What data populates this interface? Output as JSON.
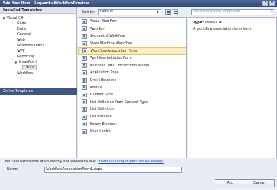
{
  "window": {
    "title": "Add New Item - SequentialWorkflowPreview",
    "controls": [
      "?",
      "×"
    ]
  },
  "left": {
    "heading": "Installed Templates",
    "tree": [
      {
        "label": "Visual C#",
        "toggle": "◢"
      },
      {
        "label": "Code"
      },
      {
        "label": "Data"
      },
      {
        "label": "General"
      },
      {
        "label": "Web"
      },
      {
        "label": "Windows Forms"
      },
      {
        "label": "WPF"
      },
      {
        "label": "Reporting"
      },
      {
        "label": "SharePoint",
        "toggle": "◢"
      },
      {
        "label": "2010"
      },
      {
        "label": "Workflow"
      }
    ],
    "online": "Online Templates"
  },
  "toolbar": {
    "sort_label": "Sort by:",
    "sort_value": "Default"
  },
  "templates": [
    {
      "label": "Visual Web Part"
    },
    {
      "label": "Web Part"
    },
    {
      "label": "Sequential Workflow"
    },
    {
      "label": "State Machine Workflow"
    },
    {
      "label": "Workflow Association Form"
    },
    {
      "label": "Workflow Initiation Form"
    },
    {
      "label": "Business Data Connectivity Model"
    },
    {
      "label": "Application Page"
    },
    {
      "label": "Event Receiver"
    },
    {
      "label": "Module"
    },
    {
      "label": "Content Type"
    },
    {
      "label": "List Definition From Content Type"
    },
    {
      "label": "List Definition"
    },
    {
      "label": "List Instance"
    },
    {
      "label": "Empty Element"
    },
    {
      "label": "User Control"
    }
  ],
  "selected_template_index": 4,
  "search": {
    "placeholder": "Search Installed Templates"
  },
  "details": {
    "type_label": "Type:",
    "type_value": "Visual C#",
    "description": "A workflow association form item."
  },
  "footer": {
    "notice": "Per user extensions are currently not allowed to load.",
    "link": "Enable loading of per user extensions",
    "name_label": "Name:",
    "name_value": "WorkflowAssociationForm1.aspx",
    "add_label": "Add",
    "cancel_label": "Cancel"
  },
  "colors": {
    "title_bar": "#3a5584",
    "selection": "#fbeec5",
    "online_bg": "#3e5680",
    "link": "#1f4fa8"
  }
}
